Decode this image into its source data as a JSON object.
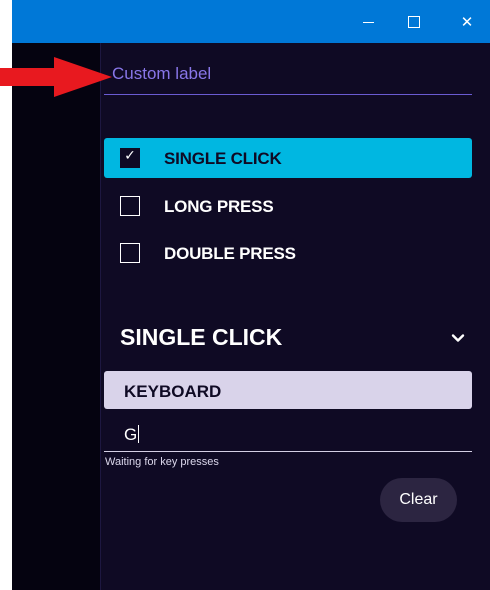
{
  "window": {
    "controls": {
      "minimize_icon": "minimize-icon",
      "maximize_icon": "maximize-icon",
      "close_glyph": "✕"
    },
    "titlebar_color": "#0078d7"
  },
  "label_field": {
    "placeholder": "Custom label"
  },
  "press_options": [
    {
      "label": "SINGLE CLICK",
      "checked": true
    },
    {
      "label": "LONG PRESS",
      "checked": false
    },
    {
      "label": "DOUBLE PRESS",
      "checked": false
    }
  ],
  "mode_section": {
    "title": "SINGLE CLICK",
    "type_label": "KEYBOARD",
    "key_value": "G",
    "helper_text": "Waiting for key presses",
    "clear_label": "Clear"
  },
  "colors": {
    "accent": "#00b7e1",
    "background": "#0f0a24",
    "annotation_arrow": "#e8191f"
  }
}
